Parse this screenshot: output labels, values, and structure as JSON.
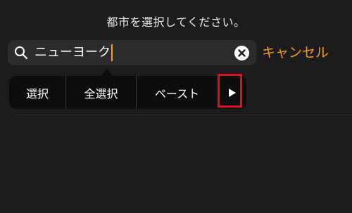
{
  "header": {
    "prompt": "都市を選択してください。"
  },
  "search": {
    "value": "ニューヨーク",
    "icon": "search-icon",
    "clear_icon": "clear-icon"
  },
  "cancel_label": "キャンセル",
  "edit_menu": {
    "items": [
      {
        "label": "選択"
      },
      {
        "label": "全選択"
      },
      {
        "label": "ペースト"
      }
    ],
    "more_icon": "triangle-right-icon"
  },
  "colors": {
    "background": "#1c1c1e",
    "accent": "#f29a25",
    "highlight": "#d9141f",
    "field": "#2c2c2e",
    "menu": "#0d0d0e"
  }
}
